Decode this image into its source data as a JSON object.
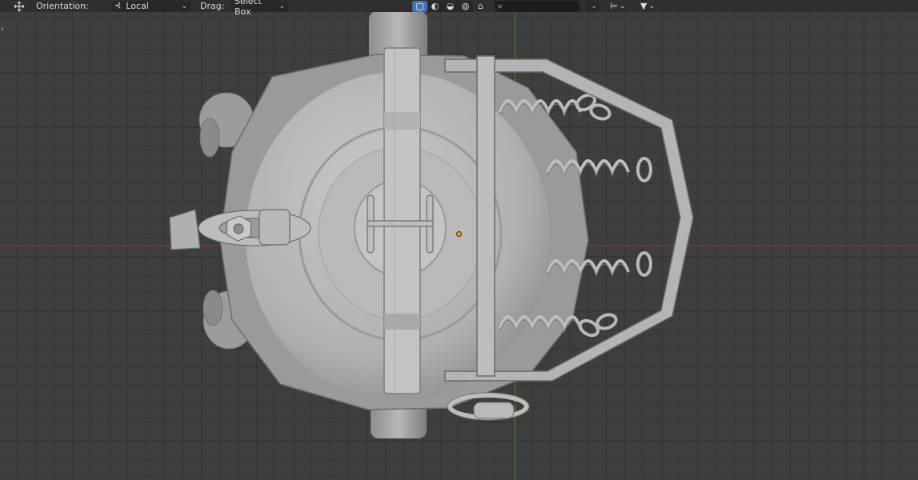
{
  "header": {
    "orientation_label": "Orientation:",
    "orientation_value": "Local",
    "drag_label": "Drag:",
    "drag_value": "Select Box",
    "search_placeholder": ""
  },
  "icons": {
    "transform": "move-gizmo-icon",
    "orientation": "local-orientation-icon",
    "shading": [
      "wireframe-shading-icon",
      "solid-shading-icon",
      "material-shading-icon",
      "rendered-shading-icon"
    ],
    "extra": "brush-icon",
    "search": "search-icon",
    "filter": "funnel-icon"
  },
  "colors": {
    "active_shading": "#4772b3",
    "x_axis": "#8e3a3a",
    "y_axis": "#5d8b2d",
    "origin": "#f39a2b",
    "mesh": "#a9a9a9"
  }
}
